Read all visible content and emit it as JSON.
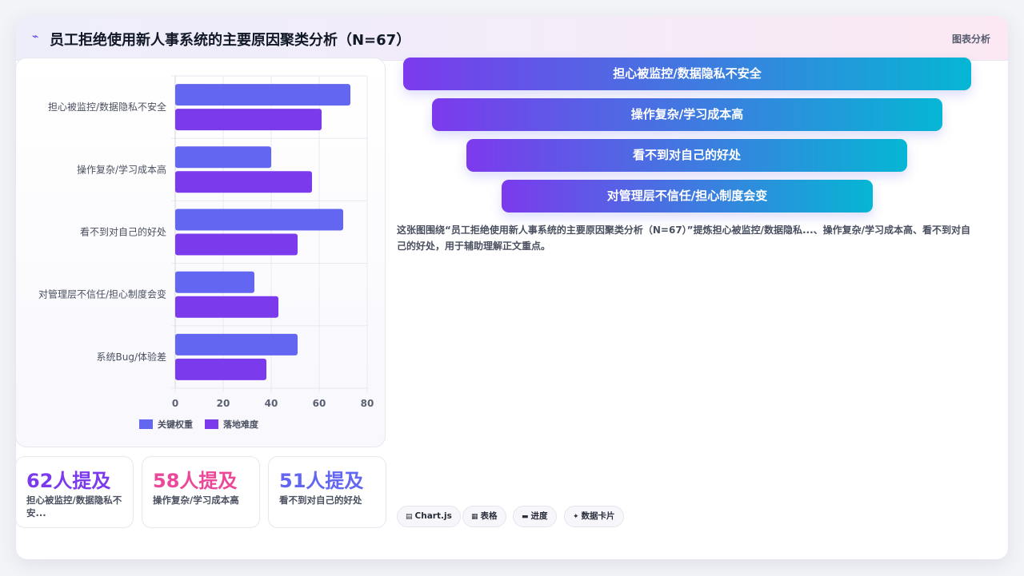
{
  "header": {
    "title": "员工拒绝使用新人事系统的主要原因聚类分析（N=67）",
    "tag": "图表分析",
    "icon": "trend-line-icon"
  },
  "chart_data": {
    "type": "bar",
    "orientation": "horizontal",
    "categories": [
      "担心被监控/数据隐私不安全",
      "操作复杂/学习成本高",
      "看不到对自己的好处",
      "对管理层不信任/担心制度会变",
      "系统Bug/体验差"
    ],
    "series": [
      {
        "name": "关键权重",
        "color": "#6366f1",
        "values": [
          73,
          40,
          70,
          33,
          51
        ]
      },
      {
        "name": "落地难度",
        "color": "#7c3aed",
        "values": [
          61,
          57,
          51,
          43,
          38
        ]
      }
    ],
    "xlim": [
      0,
      80
    ],
    "xticks": [
      0,
      20,
      40,
      60,
      80
    ],
    "grid": true,
    "legend": "bottom"
  },
  "stats": [
    {
      "value": "62人提及",
      "label": "担心被监控/数据隐私不安..."
    },
    {
      "value": "58人提及",
      "label": "操作复杂/学习成本高"
    },
    {
      "value": "51人提及",
      "label": "看不到对自己的好处"
    }
  ],
  "funnel": [
    "担心被监控/数据隐私不安全",
    "操作复杂/学习成本高",
    "看不到对自己的好处",
    "对管理层不信任/担心制度会变"
  ],
  "description": "这张图围绕“员工拒绝使用新人事系统的主要原因聚类分析（N=67）”提炼担心被监控/数据隐私...、操作复杂/学习成本高、看不到对自己的好处，用于辅助理解正文重点。",
  "chips": [
    {
      "icon": "chart-icon",
      "glyph": "▤",
      "label": "Chart.js"
    },
    {
      "icon": "table-icon",
      "glyph": "▦",
      "label": "表格"
    },
    {
      "icon": "progress-icon",
      "glyph": "▬",
      "label": "进度"
    },
    {
      "icon": "sparkle-icon",
      "glyph": "✦",
      "label": "数据卡片"
    }
  ]
}
